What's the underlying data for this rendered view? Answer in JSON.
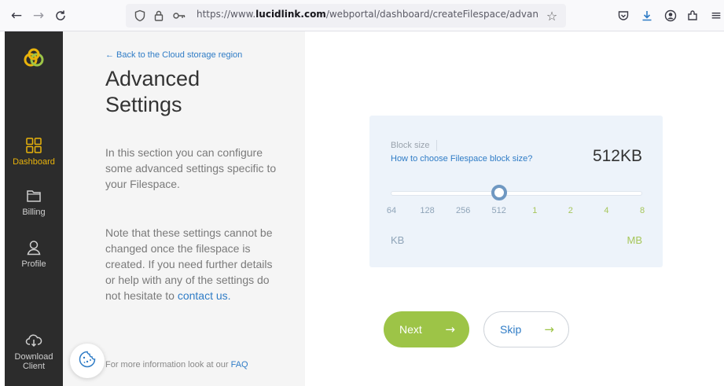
{
  "browser": {
    "url_prefix": "https://www.",
    "url_host": "lucidlink.com",
    "url_path": "/webportal/dashboard/createFilespace/advancedset",
    "icons": [
      "back-arrow-icon",
      "forward-arrow-icon",
      "reload-icon",
      "shield-icon",
      "lock-icon",
      "key-icon",
      "star-icon",
      "pocket-icon",
      "download-icon",
      "account-icon",
      "extensions-icon",
      "menu-icon"
    ]
  },
  "nav": {
    "items": [
      {
        "label": "Dashboard",
        "icon": "grid-icon"
      },
      {
        "label": "Billing",
        "icon": "folder-icon"
      },
      {
        "label": "Profile",
        "icon": "user-icon"
      },
      {
        "label": "Download Client",
        "icon": "cloud-download-icon"
      }
    ],
    "active_color": "#e9b30b"
  },
  "info": {
    "back_link": "← Back to the Cloud storage region",
    "title": "Advanced Settings",
    "para1": "In this section you can configure some advanced settings specific to your Filespace.",
    "para2_text": "Note that these settings  cannot be changed once the filespace is created. If you need further details or help with any of the settings do not hesitate to",
    "para2_link": "contact us.",
    "faq_text": "For more information look at our",
    "faq_link": "FAQ"
  },
  "block_size": {
    "label": "Block size",
    "help_link": "How to choose Filespace block size?",
    "value": "512KB",
    "ticks_kb": [
      "64",
      "128",
      "256",
      "512"
    ],
    "ticks_mb": [
      "1",
      "2",
      "4",
      "8"
    ],
    "unit_kb": "KB",
    "unit_mb": "MB",
    "selected_index": 3
  },
  "actions": {
    "next_label": "Next",
    "skip_label": "Skip",
    "arrow": "→"
  },
  "colors": {
    "accent_green": "#9dc447",
    "link_blue": "#2f7cc6",
    "nav_bg": "#2c2c2c"
  }
}
